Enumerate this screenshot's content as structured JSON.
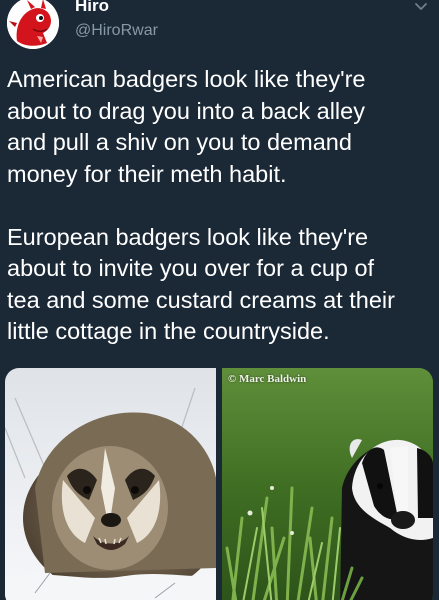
{
  "user": {
    "display_name": "Hiro",
    "handle": "@HiroRwar",
    "avatar": "red-dragon-avatar"
  },
  "menu_icon": "chevron-down-icon",
  "tweet": {
    "paragraphs": [
      "American badgers look like they're\nabout to drag you into a back alley\nand pull a shiv on you to demand\nmoney for their meth habit.",
      "European badgers look like they're\nabout to invite you over for a cup of\ntea and some custard creams at their\nlittle cottage in the countryside."
    ]
  },
  "media": {
    "left_photo": "american-badger-in-snow",
    "right_photo": "european-badger-in-grass",
    "watermark": "© Marc Baldwin"
  },
  "colors": {
    "background": "#1b2836",
    "text": "#ffffff",
    "secondary_text": "#8899a6"
  }
}
